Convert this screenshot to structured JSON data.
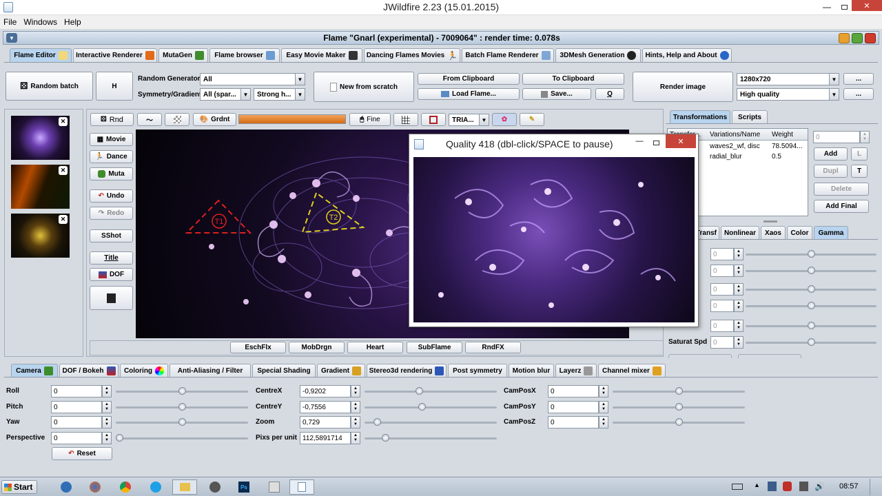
{
  "app": {
    "title": "JWildfire 2.23 (15.01.2015)",
    "menu": [
      "File",
      "Windows",
      "Help"
    ],
    "inner_title": "Flame \"Gnarl (experimental) - 7009064\" : render time: 0.078s"
  },
  "main_tabs": [
    {
      "label": "Flame Editor"
    },
    {
      "label": "Interactive Renderer"
    },
    {
      "label": "MutaGen"
    },
    {
      "label": "Flame browser"
    },
    {
      "label": "Easy Movie Maker"
    },
    {
      "label": "Dancing Flames Movies"
    },
    {
      "label": "Batch Flame Renderer"
    },
    {
      "label": "3DMesh Generation"
    },
    {
      "label": "Hints, Help and About"
    }
  ],
  "toolbar": {
    "random_batch": "Random batch",
    "h": "H",
    "random_generator_label": "Random Generator",
    "random_generator_value": "All",
    "symmetry_label": "Symmetry/Gradient",
    "symmetry_value": "All (spar...",
    "gradient_value": "Strong h...",
    "new_from_scratch": "New from scratch",
    "from_clipboard": "From Clipboard",
    "to_clipboard": "To Clipboard",
    "load_flame": "Load Flame...",
    "save": "Save...",
    "q": "Q",
    "render_image": "Render image",
    "resolution": "1280x720",
    "quality": "High quality",
    "more1": "...",
    "more2": "..."
  },
  "edit_toolbar": {
    "rnd": "Rnd",
    "grdnt": "Grdnt",
    "fine": "Fine",
    "tria": "TRIA...",
    "progress": 1.0
  },
  "left_buttons": {
    "movie": "Movie",
    "dance": "Dance",
    "muta": "Muta",
    "undo": "Undo",
    "redo": "Redo",
    "sshot": "SShot",
    "title": "Title",
    "dof": "DOF"
  },
  "canvas": {
    "triangle1": "T1",
    "triangle2": "T2"
  },
  "bottom_canvas_buttons": [
    "EschFlx",
    "MobDrgn",
    "Heart",
    "SubFlame",
    "RndFX"
  ],
  "popup": {
    "title": "Quality 418 (dbl-click/SPACE to pause)"
  },
  "right_panel": {
    "tabs": [
      "Transformations",
      "Scripts"
    ],
    "table_headers": [
      "Transfor...",
      "Variations/Name",
      "Weight"
    ],
    "rows": [
      {
        "name": "waves2_wf, disc",
        "weight": "78.5094..."
      },
      {
        "name": "radial_blur",
        "weight": "0.5"
      }
    ],
    "spinner_value": "0",
    "add": "Add",
    "l": "L",
    "dupl": "Dupl",
    "t": "T",
    "delete": "Delete",
    "add_final": "Add Final",
    "sub_tabs": [
      "Transf",
      "Nonlinear",
      "Xaos",
      "Color",
      "Gamma"
    ],
    "gamma_rows": [
      {
        "label": "",
        "value": "0",
        "knob": 0.5
      },
      {
        "label": "pd",
        "value": "0",
        "knob": 0.5
      },
      {
        "label": "",
        "value": "0",
        "knob": 0.5
      },
      {
        "label": "od",
        "value": "0",
        "knob": 0.5
      },
      {
        "label": "n",
        "value": "0",
        "knob": 0.5
      },
      {
        "label": "Saturat Spd",
        "value": "0",
        "knob": 0.5
      }
    ]
  },
  "bottom_tabs": [
    {
      "label": "Camera"
    },
    {
      "label": "DOF / Bokeh"
    },
    {
      "label": "Coloring"
    },
    {
      "label": "Anti-Aliasing / Filter"
    },
    {
      "label": "Special Shading"
    },
    {
      "label": "Gradient"
    },
    {
      "label": "Stereo3d rendering"
    },
    {
      "label": "Post symmetry"
    },
    {
      "label": "Motion blur"
    },
    {
      "label": "Layerz"
    },
    {
      "label": "Channel mixer"
    }
  ],
  "camera": {
    "col1": [
      {
        "label": "Roll",
        "value": "0",
        "knob": 0.5
      },
      {
        "label": "Pitch",
        "value": "0",
        "knob": 0.5
      },
      {
        "label": "Yaw",
        "value": "0",
        "knob": 0.5
      },
      {
        "label": "Perspective",
        "value": "0",
        "knob": 0.0
      }
    ],
    "col2": [
      {
        "label": "CentreX",
        "value": "-0,9202",
        "knob": 0.41
      },
      {
        "label": "CentreY",
        "value": "-0,7556",
        "knob": 0.43
      },
      {
        "label": "Zoom",
        "value": "0,729",
        "knob": 0.07
      },
      {
        "label": "Pixs per unit",
        "value": "112,5891714",
        "knob": 0.14
      }
    ],
    "col3": [
      {
        "label": "CamPosX",
        "value": "0",
        "knob": 0.5
      },
      {
        "label": "CamPosY",
        "value": "0",
        "knob": 0.5
      },
      {
        "label": "CamPosZ",
        "value": "0",
        "knob": 0.5
      }
    ],
    "reset": "Reset"
  },
  "taskbar": {
    "start": "Start",
    "time": "08:57"
  }
}
